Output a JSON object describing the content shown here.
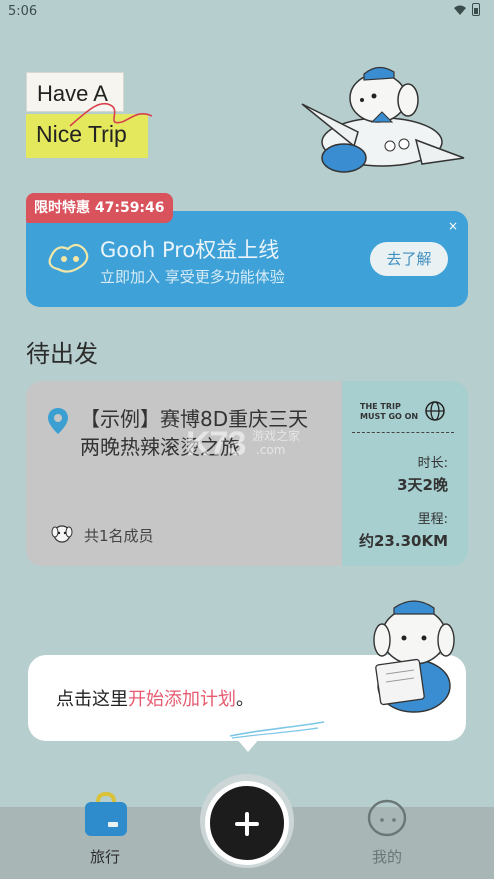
{
  "status_bar": {
    "time": "5:06",
    "wifi_icon": "wifi-icon",
    "battery_icon": "battery-icon"
  },
  "header": {
    "logo_line1": "Have A",
    "logo_line2": "Nice Trip",
    "illustration": "dog-in-airplane"
  },
  "promo": {
    "timer": "限时特惠 47:59:46",
    "title": "Gooh Pro权益上线",
    "subtitle": "立即加入 享受更多功能体验",
    "button": "去了解",
    "close": "×",
    "icon": "pro-logo-icon",
    "color": "#3ea1d8",
    "timer_color": "#d9535d"
  },
  "section": {
    "title": "待出发"
  },
  "trip": {
    "title": "【示例】赛博8D重庆三天两晚热辣滚烫之旅",
    "members": "共1名成员",
    "slogan_line1": "THE TRIP",
    "slogan_line2": "MUST GO ON",
    "duration_label": "时长:",
    "duration_value": "3天2晚",
    "distance_label": "里程:",
    "distance_value": "约23.30KM"
  },
  "watermark": {
    "logo": "K73",
    "text": "游戏之家",
    "domain": ".com"
  },
  "tooltip": {
    "prefix": "点击这里",
    "highlight": "开始添加计划",
    "suffix": "。",
    "highlight_color": "#e65b70"
  },
  "bottom_nav": {
    "travel_label": "旅行",
    "mine_label": "我的",
    "fab_icon": "plus-icon"
  }
}
